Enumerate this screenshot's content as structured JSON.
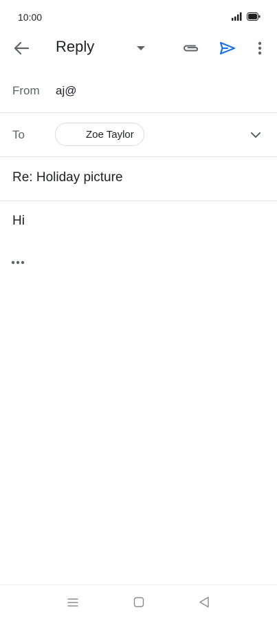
{
  "status_bar": {
    "time": "10:00",
    "icons": [
      "signal-icon",
      "battery-icon"
    ]
  },
  "app_bar": {
    "back_icon": "arrow-left-icon",
    "title": "Reply",
    "dropdown_icon": "caret-down-icon",
    "attach_icon": "paperclip-icon",
    "send_icon": "send-icon",
    "more_icon": "more-vert-icon"
  },
  "from": {
    "label": "From",
    "value": "aj@"
  },
  "to": {
    "label": "To",
    "recipient": "Zoe Taylor",
    "expand_icon": "chevron-down-icon"
  },
  "subject": {
    "value": "Re: Holiday picture"
  },
  "body": {
    "text": "Hi",
    "quoted_icon": "more-horiz-icon"
  },
  "nav_bar": {
    "menu_icon": "menu-icon",
    "home_icon": "home-square-icon",
    "back_icon": "back-triangle-icon"
  },
  "colors": {
    "accent": "#1a73e8",
    "text": "#202124",
    "secondary": "#5f6368",
    "divider": "#e6e6e6"
  }
}
